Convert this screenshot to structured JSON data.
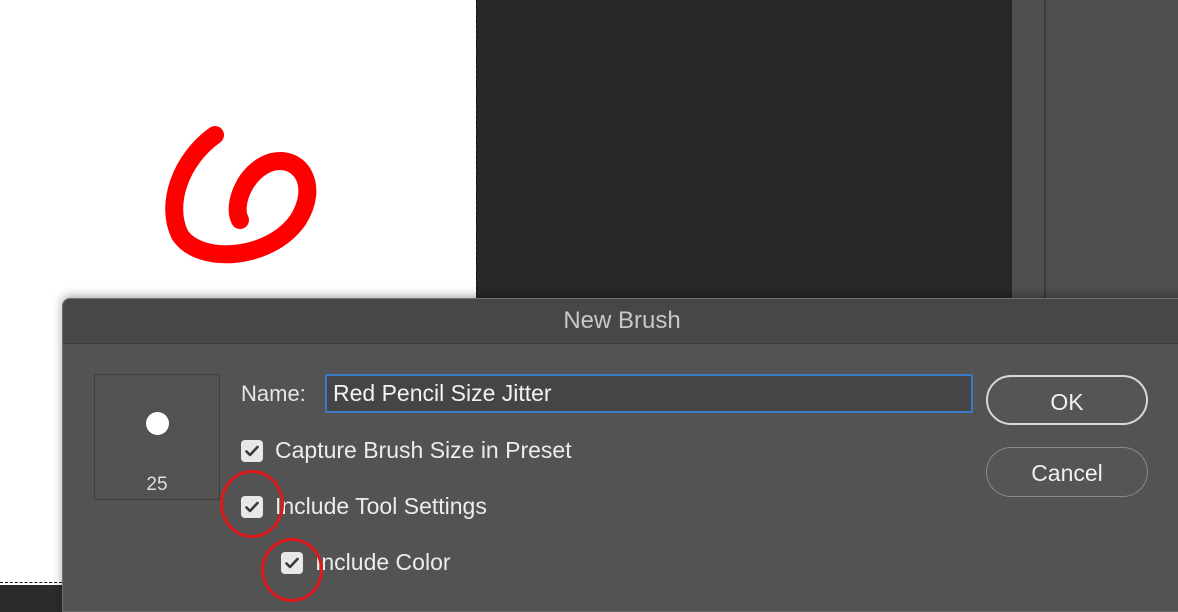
{
  "dialog": {
    "title": "New Brush",
    "brush_preview": {
      "size": "25"
    },
    "name_label": "Name:",
    "name_value": "Red Pencil Size Jitter",
    "options": [
      {
        "label": "Capture Brush Size in Preset",
        "checked": true
      },
      {
        "label": "Include Tool Settings",
        "checked": true
      },
      {
        "label": "Include Color",
        "checked": true
      }
    ],
    "ok_label": "OK",
    "cancel_label": "Cancel"
  },
  "colors": {
    "accent_red": "#e0191c",
    "stroke_red": "#ff0000",
    "focus_blue": "#3a78c8",
    "dialog_bg": "#535353"
  },
  "icons": [
    "checkmark-icon",
    "brush-tip-dot"
  ]
}
